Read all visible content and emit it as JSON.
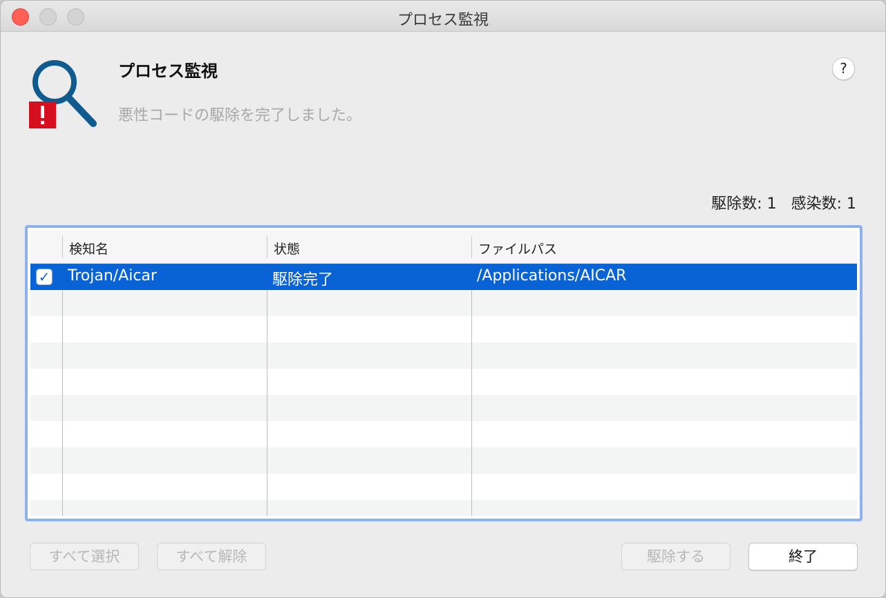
{
  "window": {
    "title": "プロセス監視"
  },
  "header": {
    "title": "プロセス監視",
    "message": "悪性コードの駆除を完了しました。",
    "help_label": "?"
  },
  "summary": {
    "removed_label": "駆除数: 1",
    "infected_label": "感染数: 1"
  },
  "table": {
    "columns": [
      "検知名",
      "状態",
      "ファイルパス"
    ],
    "rows": [
      {
        "checked": true,
        "name": "Trojan/Aicar",
        "status": "駆除完了",
        "path": "/Applications/AICAR"
      }
    ]
  },
  "buttons": {
    "select_all": "すべて選択",
    "deselect_all": "すべて解除",
    "remove": "駆除する",
    "close": "終了"
  },
  "colors": {
    "selection": "#0a63d4",
    "logo_blue": "#0f5a8f",
    "alert_red": "#d60f1f"
  }
}
